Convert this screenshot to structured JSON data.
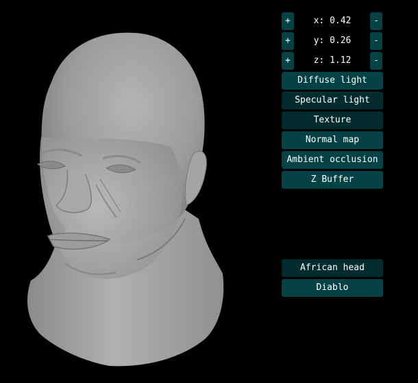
{
  "coords": [
    {
      "plus": "+",
      "label": "x: 0.42",
      "minus": "-"
    },
    {
      "plus": "+",
      "label": "y: 0.26",
      "minus": "-"
    },
    {
      "plus": "+",
      "label": "z: 1.12",
      "minus": "-"
    }
  ],
  "shading_buttons": [
    {
      "label": "Diffuse light"
    },
    {
      "label": "Specular light"
    },
    {
      "label": "Texture"
    },
    {
      "label": "Normal map"
    },
    {
      "label": "Ambient occlusion"
    },
    {
      "label": "Z Buffer"
    }
  ],
  "model_buttons": [
    {
      "label": "African head"
    },
    {
      "label": "Diablo"
    }
  ],
  "colors": {
    "background": "#000000",
    "button": "#044246",
    "button_selected": "#032c2e",
    "text": "#ffffff",
    "model_shade": "#a6a6a6"
  }
}
